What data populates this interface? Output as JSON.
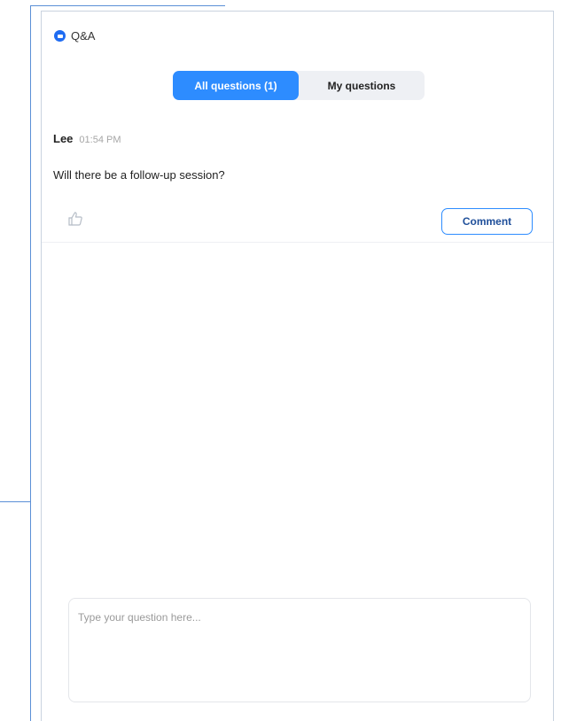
{
  "window": {
    "title": "Q&A"
  },
  "tabs": [
    {
      "label": "All questions (1)",
      "active": true
    },
    {
      "label": "My questions",
      "active": false
    }
  ],
  "questions": [
    {
      "author": "Lee",
      "time": "01:54 PM",
      "text": "Will there be a follow-up session?",
      "like_icon": "thumbs-up-icon",
      "comment_label": "Comment"
    }
  ],
  "composer": {
    "placeholder": "Type your question here...",
    "value": ""
  },
  "colors": {
    "accent": "#2d8cff",
    "logo": "#1f6cf2",
    "frame_accent": "#5b8fd6"
  }
}
